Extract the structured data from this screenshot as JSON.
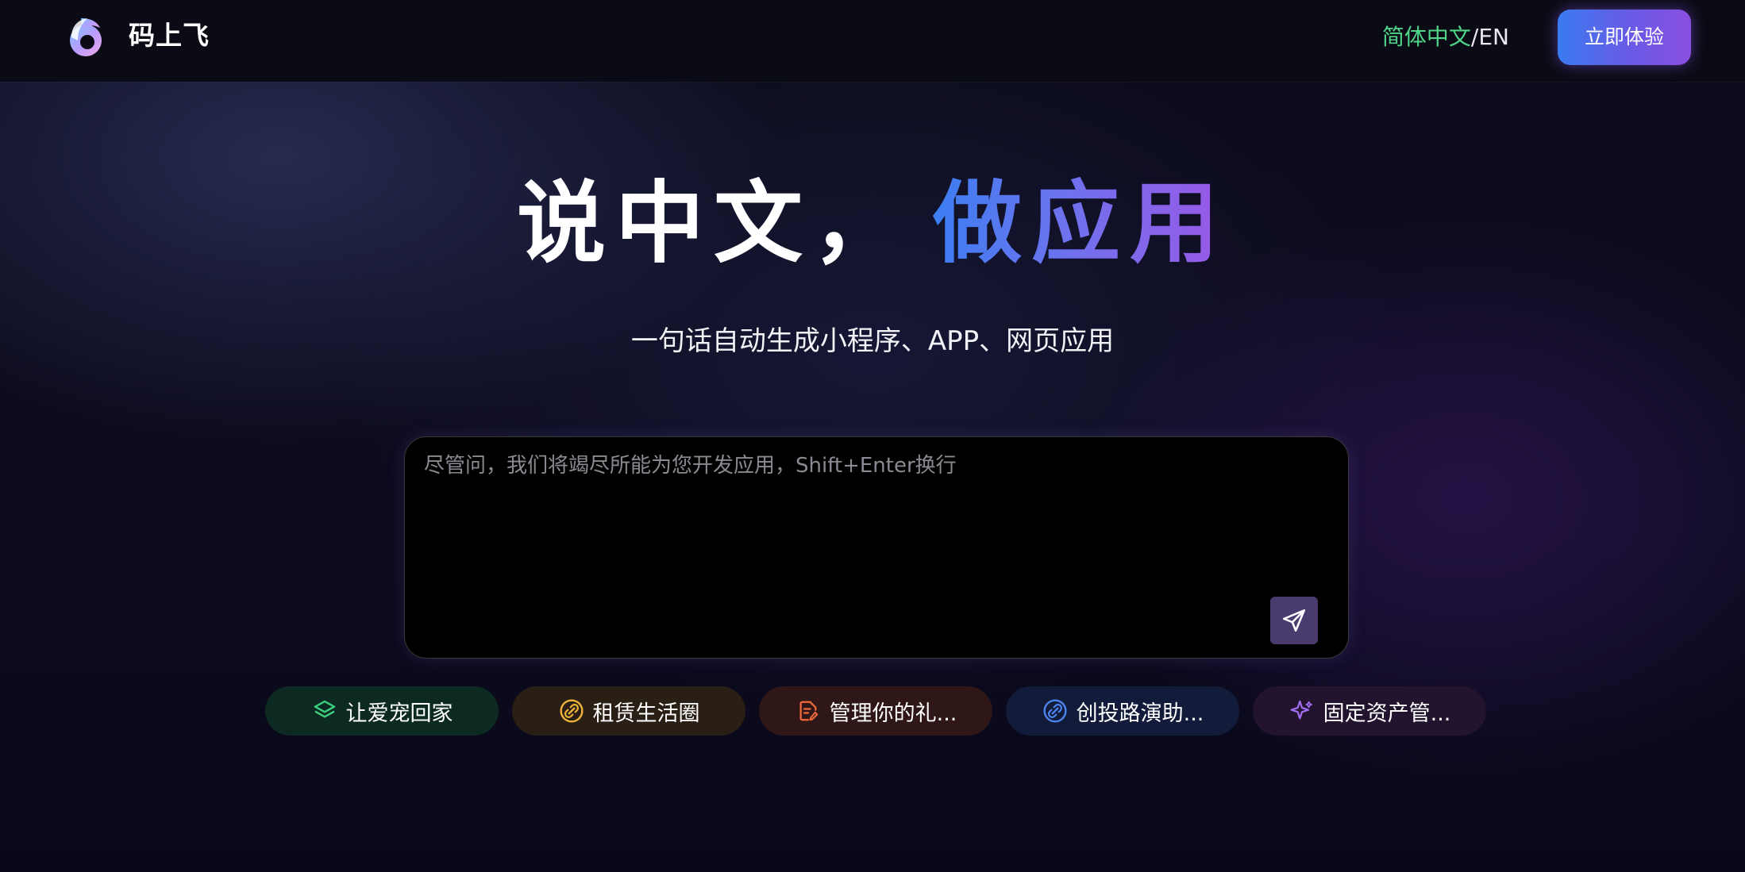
{
  "header": {
    "brand": "码上飞",
    "lang_zh": "简体中文",
    "lang_sep": "/",
    "lang_en": "EN",
    "cta_label": "立即体验"
  },
  "hero": {
    "title_part1": "说中文，",
    "title_part2": "做应用",
    "subtitle": "一句话自动生成小程序、APP、网页应用"
  },
  "prompt": {
    "placeholder": "尽管问，我们将竭尽所能为您开发应用，Shift+Enter换行",
    "value": ""
  },
  "suggestions": [
    {
      "label": "让爱宠回家",
      "icon": "layers-icon",
      "color": "#3ccf7e"
    },
    {
      "label": "租赁生活圈",
      "icon": "link-circle-icon",
      "color": "#f0b43a"
    },
    {
      "label": "管理你的礼...",
      "icon": "document-edit-icon",
      "color": "#ef6a3b"
    },
    {
      "label": "创投路演助...",
      "icon": "link-circle-icon",
      "color": "#4d86f2"
    },
    {
      "label": "固定资产管...",
      "icon": "sparkle-icon",
      "color": "#a06cf0"
    }
  ],
  "colors": {
    "accent_green": "#4fd68a",
    "cta_gradient_start": "#3a7bf0",
    "cta_gradient_end": "#8b4fe0",
    "send_button": "#4a3b6e"
  }
}
